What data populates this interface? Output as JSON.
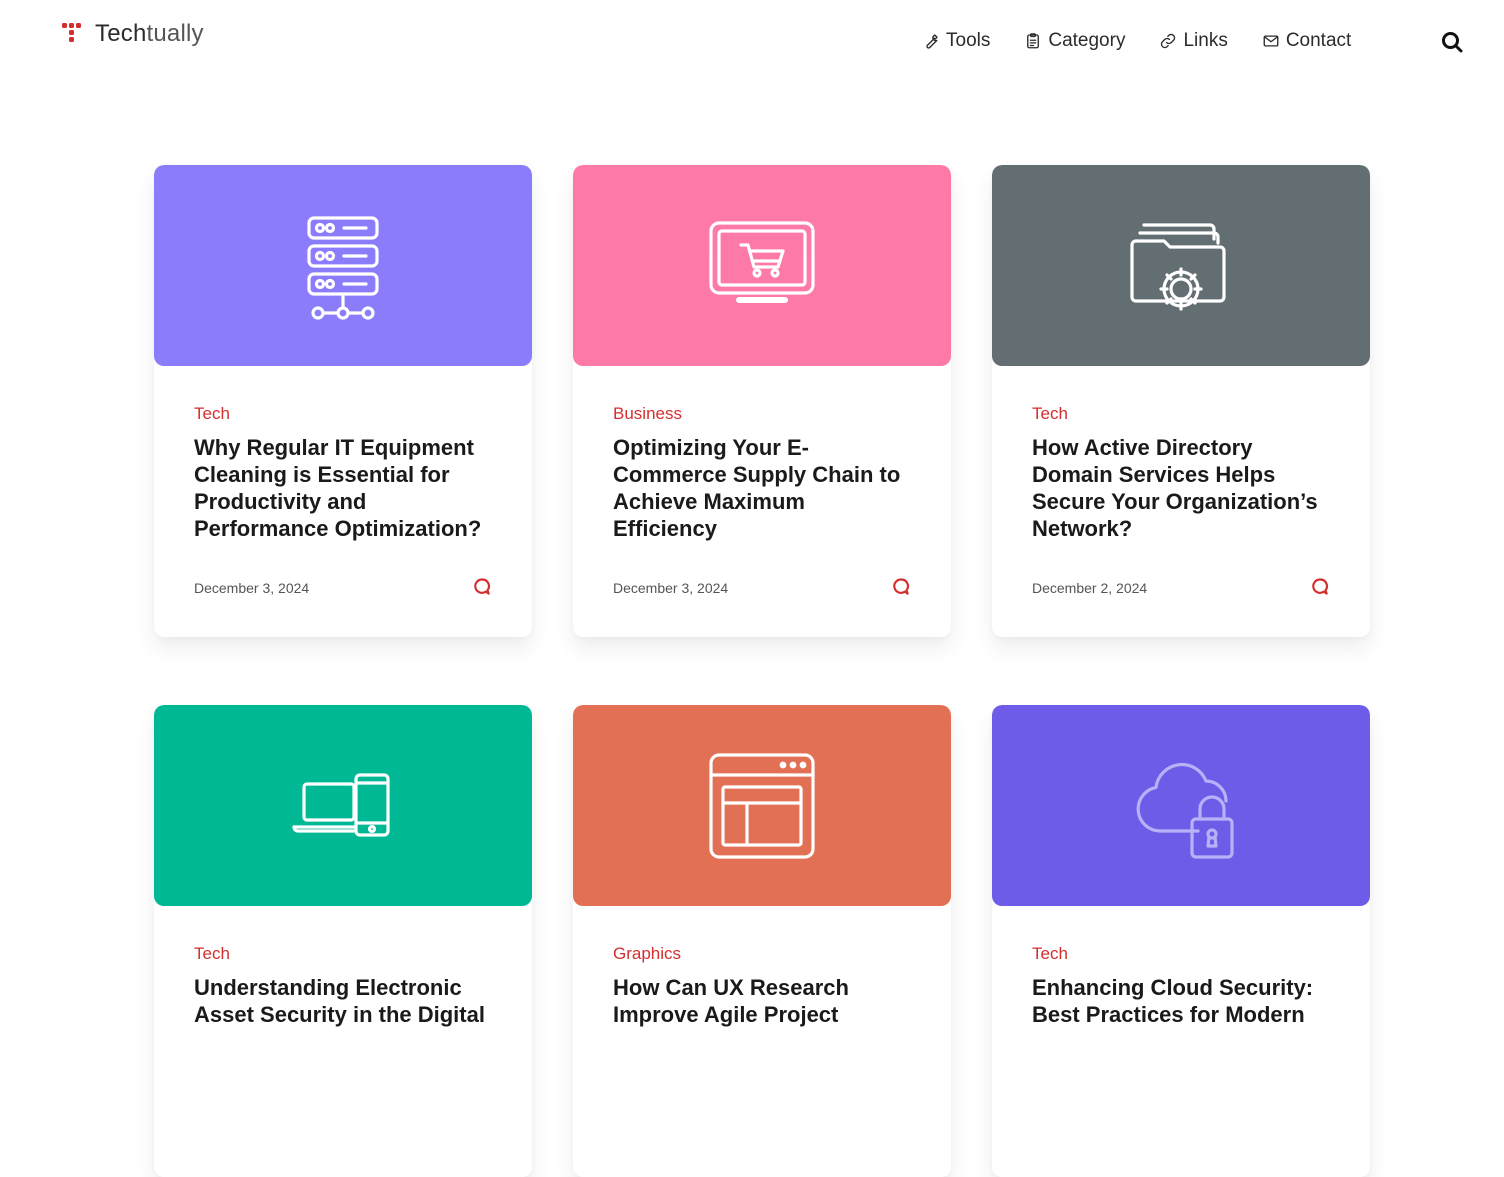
{
  "site": {
    "logo_text_main": "Tech",
    "logo_text_rest": "tually",
    "accent_color": "#d32f2f"
  },
  "nav": {
    "items": [
      {
        "label": "Tools",
        "icon": "wrench-icon"
      },
      {
        "label": "Category",
        "icon": "clipboard-icon"
      },
      {
        "label": "Links",
        "icon": "link-icon"
      },
      {
        "label": "Contact",
        "icon": "mail-icon"
      }
    ],
    "search_icon": "search-icon"
  },
  "posts": [
    {
      "category": "Tech",
      "title": "Why Regular IT Equipment Cleaning is Essential for Productivity and Performance Optimization?",
      "date": "December 3, 2024",
      "thumb_color": "#8a7cfb",
      "thumb_icon": "server-network-icon"
    },
    {
      "category": "Business",
      "title": "Optimizing Your E-Commerce Supply Chain to Achieve Maximum Efficiency",
      "date": "December 3, 2024",
      "thumb_color": "#fd79a8",
      "thumb_icon": "monitor-cart-icon"
    },
    {
      "category": "Tech",
      "title": "How Active Directory Domain Services Helps Secure Your Organization’s Network?",
      "date": "December 2, 2024",
      "thumb_color": "#636e72",
      "thumb_icon": "folder-gear-icon"
    },
    {
      "category": "Tech",
      "title": "Understanding Electronic Asset Security in the Digital",
      "date": "",
      "thumb_color": "#00b894",
      "thumb_icon": "laptop-phone-icon"
    },
    {
      "category": "Graphics",
      "title": "How Can UX Research Improve Agile Project",
      "date": "",
      "thumb_color": "#e17055",
      "thumb_icon": "browser-layout-icon"
    },
    {
      "category": "Tech",
      "title": "Enhancing Cloud Security: Best Practices for Modern",
      "date": "",
      "thumb_color": "#6c5ce7",
      "thumb_icon": "cloud-lock-icon"
    }
  ]
}
